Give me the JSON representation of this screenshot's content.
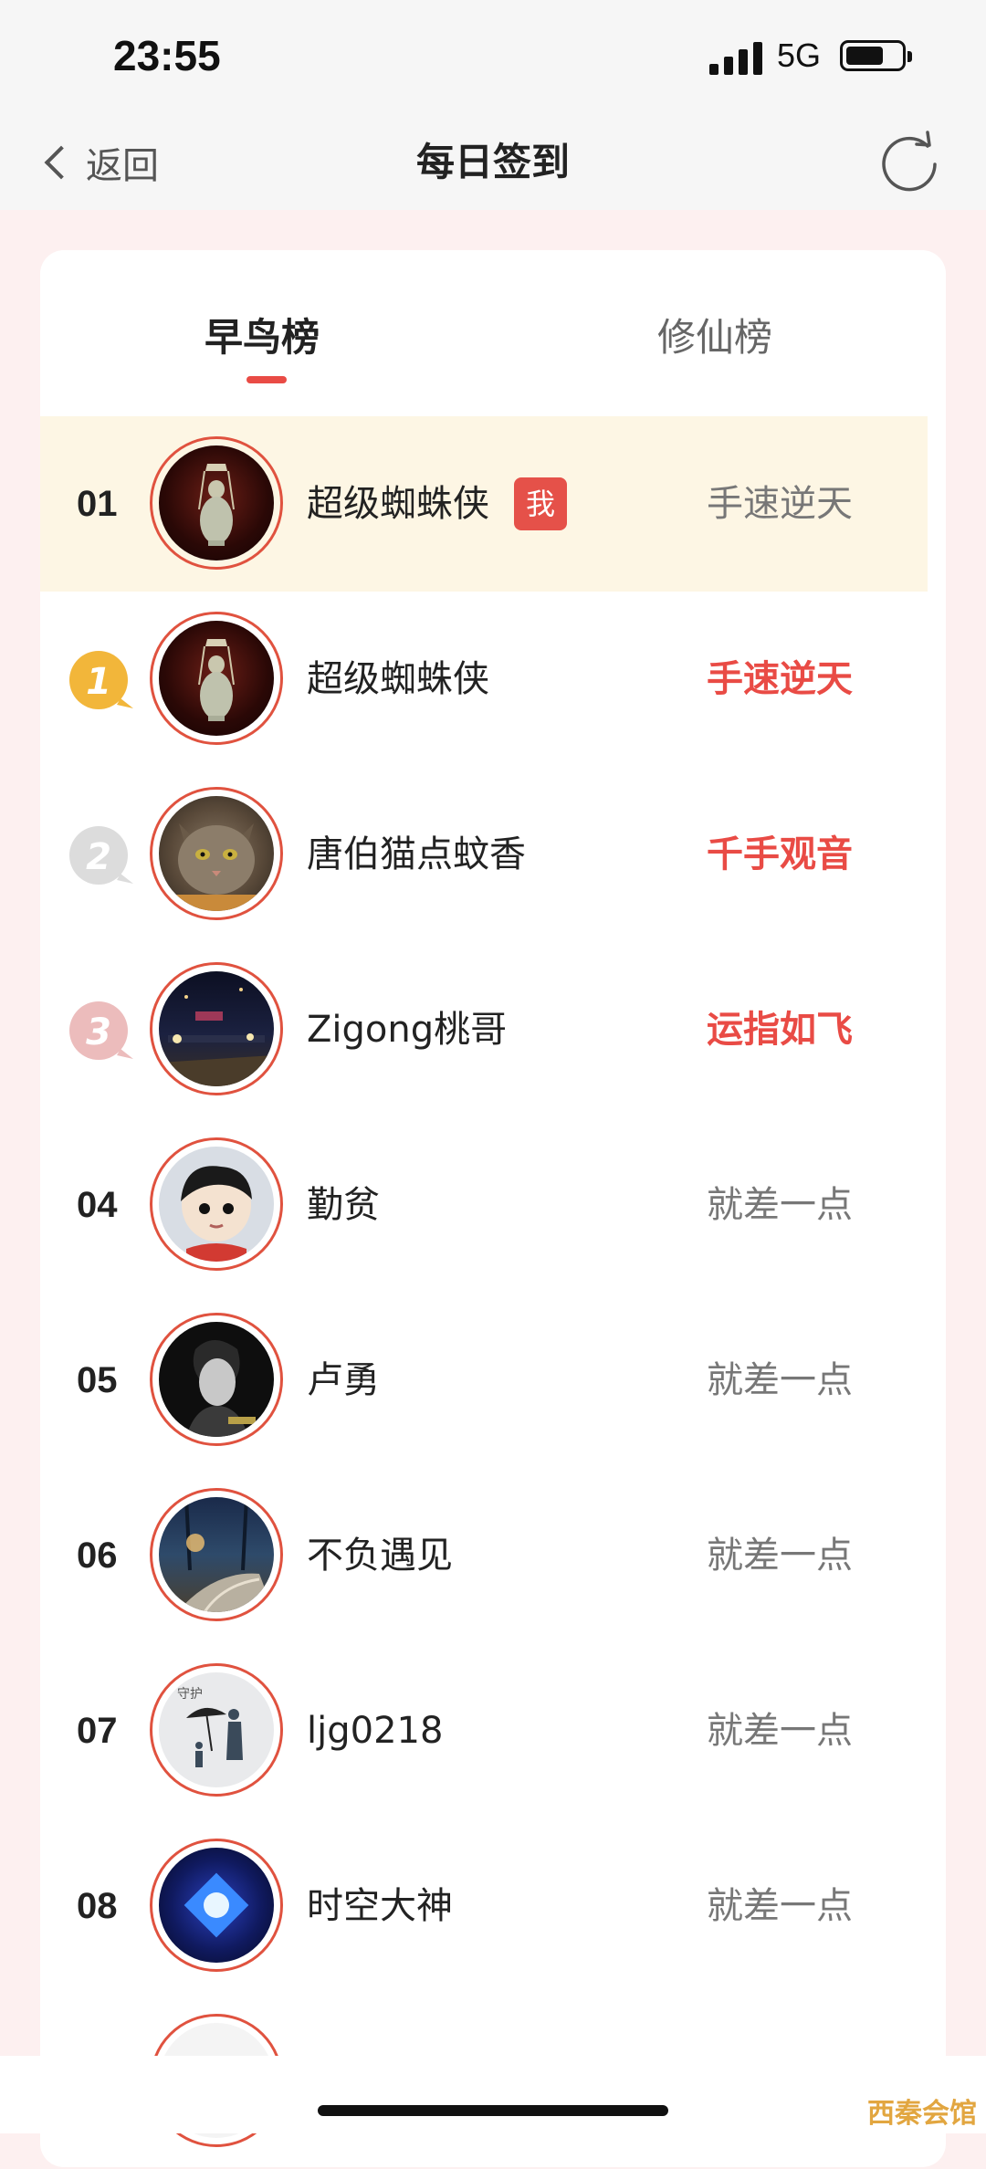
{
  "status_bar": {
    "time": "23:55",
    "network": "5G",
    "battery_level": 0.7
  },
  "nav": {
    "back_label": "返回",
    "title": "每日签到"
  },
  "tabs": [
    {
      "label": "早鸟榜",
      "active": true
    },
    {
      "label": "修仙榜",
      "active": false
    }
  ],
  "my_row": {
    "rank": "01",
    "name": "超级蜘蛛侠",
    "badge": "我",
    "tag": "手速逆天",
    "avatar": "jade-vase"
  },
  "rows": [
    {
      "rank": "1",
      "medal": "gold",
      "name": "超级蜘蛛侠",
      "tag": "手速逆天",
      "tag_red": true,
      "avatar": "jade-vase"
    },
    {
      "rank": "2",
      "medal": "silver",
      "name": "唐伯猫点蚊香",
      "tag": "千手观音",
      "tag_red": true,
      "avatar": "cat"
    },
    {
      "rank": "3",
      "medal": "bronze",
      "name": "Zigong桃哥",
      "tag": "运指如飞",
      "tag_red": true,
      "avatar": "night-city"
    },
    {
      "rank": "04",
      "name": "勤贫",
      "tag": "就差一点",
      "tag_red": false,
      "avatar": "cartoon-boy"
    },
    {
      "rank": "05",
      "name": "卢勇",
      "tag": "就差一点",
      "tag_red": false,
      "avatar": "portrait"
    },
    {
      "rank": "06",
      "name": "不负遇见",
      "tag": "就差一点",
      "tag_red": false,
      "avatar": "night-road"
    },
    {
      "rank": "07",
      "name": "ljg0218",
      "tag": "就差一点",
      "tag_red": false,
      "avatar": "umbrella-art"
    },
    {
      "rank": "08",
      "name": "时空大神",
      "tag": "就差一点",
      "tag_red": false,
      "avatar": "blue-cube"
    }
  ],
  "watermark": "西秦会馆",
  "colors": {
    "accent_red": "#e94b45",
    "me_row_bg": "#fdf6e4",
    "gold": "#f2b63a",
    "silver": "#d9d9d9",
    "bronze": "#e8b5b5"
  }
}
